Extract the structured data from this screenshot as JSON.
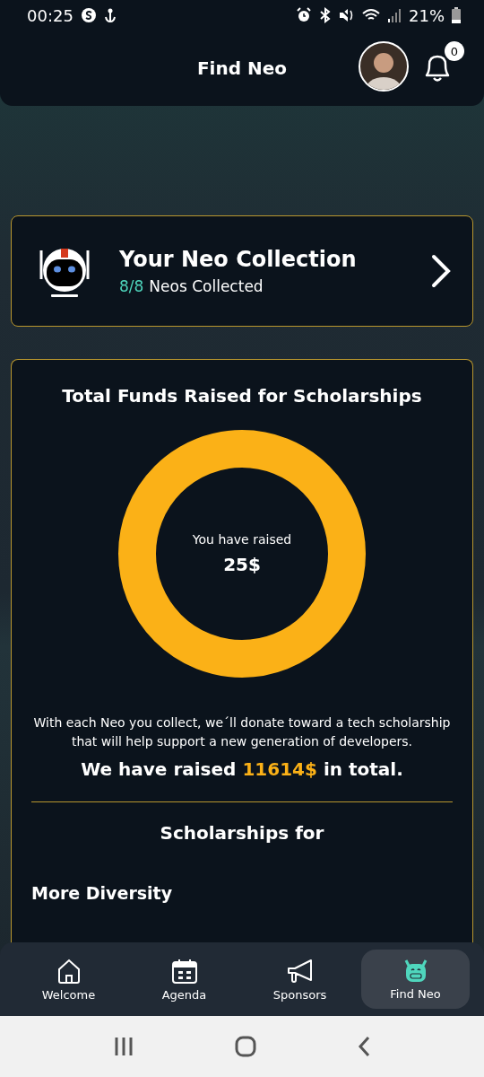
{
  "status_bar": {
    "time": "00:25",
    "battery": "21%"
  },
  "header": {
    "title": "Find Neo",
    "notification_count": "0"
  },
  "collection": {
    "title": "Your Neo Collection",
    "count": "8/8",
    "label": "Neos Collected"
  },
  "funds": {
    "title": "Total Funds Raised for Scholarships",
    "donut_label": "You have raised",
    "donut_amount": "25$",
    "description": "With each Neo you collect, we´ll donate toward a tech scholarship that will help support a new generation of developers.",
    "total_prefix": "We have raised",
    "total_amount": "11614$",
    "total_suffix": "in total.",
    "scholarships_title": "Scholarships for",
    "scholarships": [
      "More Diversity"
    ]
  },
  "nav": [
    {
      "label": "Welcome",
      "kind": "home",
      "selected": false
    },
    {
      "label": "Agenda",
      "kind": "calendar",
      "selected": false
    },
    {
      "label": "Sponsors",
      "kind": "megaphone",
      "selected": false
    },
    {
      "label": "Find Neo",
      "kind": "robot",
      "selected": true
    }
  ]
}
